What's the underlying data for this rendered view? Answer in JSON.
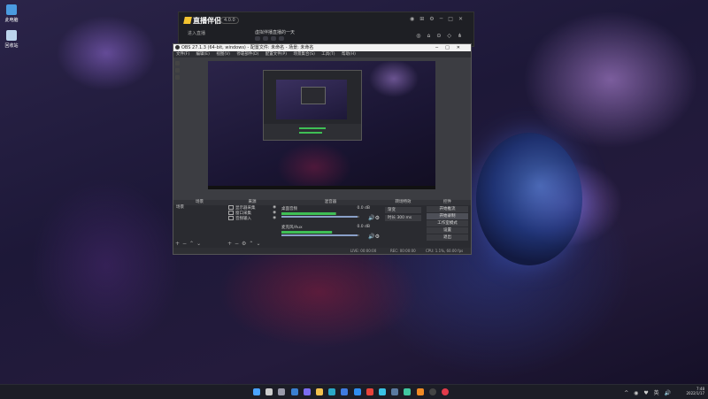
{
  "desktop": {
    "icons": [
      {
        "label": "此电脑",
        "color": "#4a9be0"
      },
      {
        "label": "回收站",
        "color": "#bcd4ec"
      }
    ]
  },
  "companion_app": {
    "brand": "直播伴侣",
    "version_badge": "4.0.0",
    "tabs": [
      "进入直播",
      "",
      ""
    ],
    "stream_title": "虚拟伴播直播的一天",
    "chips": [
      "",
      "",
      "",
      ""
    ]
  },
  "obs": {
    "title": "OBS 27.1.3 (64-bit, windows) - 配置文件: 未命名 - 场景: 未命名",
    "menu": [
      "文件(F)",
      "编辑(E)",
      "视图(V)",
      "停靠部件(D)",
      "配置文件(P)",
      "场景集合(S)",
      "工具(T)",
      "帮助(H)"
    ],
    "scene_label": "未选择源",
    "scene_buttons": [
      "属性",
      "滤镜"
    ],
    "docks": {
      "scenes": {
        "header": "场景",
        "items": [
          "场景"
        ]
      },
      "sources": {
        "header": "来源",
        "items": [
          {
            "label": "显示器采集"
          },
          {
            "label": "窗口采集"
          },
          {
            "label": "音频输入"
          }
        ]
      },
      "mixer": {
        "header": "混音器",
        "channels": [
          {
            "name": "桌面音频",
            "db": "0.0 dB",
            "level": 0.7
          },
          {
            "name": "麦克风/Aux",
            "db": "0.0 dB",
            "level": 0.65
          }
        ]
      },
      "transitions": {
        "header": "转场特效",
        "type": "渐变",
        "duration_label": "时长",
        "duration": "300 ms"
      },
      "controls": {
        "header": "控件",
        "buttons": [
          "开始推流",
          "开始录制",
          "工作室模式",
          "设置",
          "退出"
        ],
        "hover_index": 1
      }
    },
    "status": {
      "live": "LIVE: 00:00:00",
      "rec": "REC: 00:00:00",
      "cpu": "CPU: 1.1%, 60.00 fps"
    }
  },
  "taskbar": {
    "apps": [
      {
        "name": "windows-start",
        "color": "#4aa3ff"
      },
      {
        "name": "search",
        "color": "#cccccc"
      },
      {
        "name": "task-view",
        "color": "#9a9aaa"
      },
      {
        "name": "widgets",
        "color": "#3a7fd0"
      },
      {
        "name": "chat",
        "color": "#7b6cf0"
      },
      {
        "name": "file-explorer",
        "color": "#f2c14e"
      },
      {
        "name": "edge",
        "color": "#2aa8c7"
      },
      {
        "name": "store",
        "color": "#3f7be0"
      },
      {
        "name": "app-blue",
        "color": "#2f8ef0"
      },
      {
        "name": "app-red",
        "color": "#e8443b"
      },
      {
        "name": "app-cyan",
        "color": "#39c3e6"
      },
      {
        "name": "steam",
        "color": "#5a7aa0"
      },
      {
        "name": "app-music",
        "color": "#40c8a0"
      },
      {
        "name": "app-orange",
        "color": "#f08a24"
      },
      {
        "name": "obs",
        "color": "#444444"
      },
      {
        "name": "app-red2",
        "color": "#e23a4a"
      }
    ],
    "tray": "^ ◉ ♥ 英 🔊",
    "time": "7:48",
    "date": "2022/1/17"
  }
}
